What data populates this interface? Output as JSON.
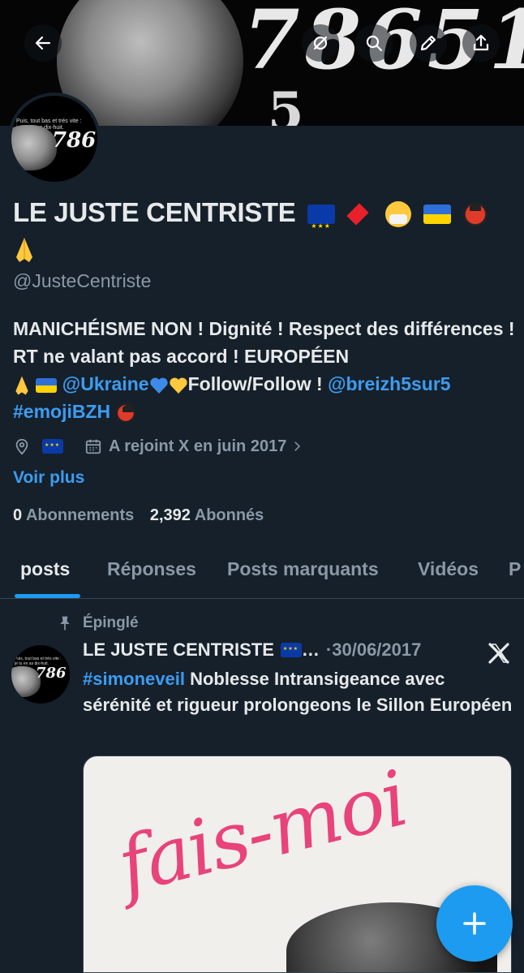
{
  "banner": {
    "digits": "78651",
    "digits_lower": "5"
  },
  "avatar": {
    "caption": "Puis, tout bas et très vite :\nje tu en as dix-huit.",
    "number": "786"
  },
  "profile": {
    "name": "LE JUSTE CENTRISTE",
    "handle": "@JusteCentriste",
    "bio_1": "MANICHÉISME NON ! Dignité ! Respect des différences ! RT ne valant pas accord ! EUROPÉEN",
    "bio_ukraine_link": "@Ukraine",
    "bio_2": "Follow/Follow !",
    "bio_breizh_link": "@breizh5sur5",
    "bio_hashtag": "#emojiBZH",
    "joined": "A rejoint X en juin 2017",
    "see_more": "Voir plus",
    "following_count": "0",
    "following_label": "Abonnements",
    "followers_count": "2,392",
    "followers_label": "Abonnés"
  },
  "tabs": [
    {
      "label": "posts"
    },
    {
      "label": "Réponses"
    },
    {
      "label": "Posts marquants"
    },
    {
      "label": "Vidéos"
    },
    {
      "label": "P"
    }
  ],
  "post": {
    "pinned_label": "Épinglé",
    "author": "LE JUSTE CENTRISTE",
    "ellipsis": "…",
    "dot": "·",
    "date": "30/06/2017",
    "hashtag": "#simoneveil",
    "text": "Noblesse Intransigeance avec sérénité et rigueur prolongeons le Sillon Européen",
    "image_title": "fais-moi"
  },
  "icons": [
    "back-arrow-icon",
    "hide-reply-icon",
    "search-icon",
    "edit-icon",
    "share-icon",
    "location-icon",
    "calendar-icon",
    "chevron-right-icon",
    "pin-icon",
    "x-logo-icon",
    "plus-icon"
  ],
  "colors": {
    "background": "#15202b",
    "accent": "#1d9bf0",
    "link": "#3d9cf0",
    "secondary_text": "#8b98a5"
  }
}
